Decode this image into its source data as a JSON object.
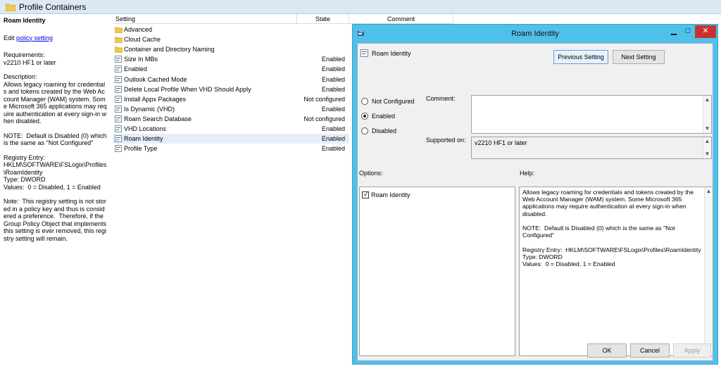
{
  "header": {
    "title": "Profile Containers"
  },
  "left_pane": {
    "heading": "Roam Identity",
    "edit_prefix": "Edit ",
    "edit_link": "policy setting",
    "requirements_label": "Requirements:",
    "requirements_value": "v2210 HF1 or later",
    "description_label": "Description:",
    "description_text": "Allows legacy roaming for credentials and tokens created by the Web Account Manager (WAM) system. Some Microsoft 365 applications may require authentication at every sign-in when disabled.",
    "note": "NOTE:  Default is Disabled (0) which is the same as \"Not Configured\"",
    "registry_label": "Registry Entry:",
    "registry_path": "HKLM\\SOFTWARE\\FSLogix\\Profiles\\RoamIdentity",
    "registry_type": "Type: DWORD",
    "registry_values": "Values:  0 = Disabled, 1 = Enabled",
    "note2": "Note:  This registry setting is not stored in a policy key and thus is considered a preference.  Therefore, if the Group Policy Object that implements this setting is ever removed, this registry setting will remain."
  },
  "list": {
    "columns": {
      "setting": "Setting",
      "state": "State",
      "comment": "Comment"
    },
    "rows": [
      {
        "name": "Advanced",
        "state": "",
        "icon": "folder-icon"
      },
      {
        "name": "Cloud Cache",
        "state": "",
        "icon": "folder-icon"
      },
      {
        "name": "Container and Directory Naming",
        "state": "",
        "icon": "folder-icon"
      },
      {
        "name": "Size In MBs",
        "state": "Enabled",
        "icon": "policy-icon"
      },
      {
        "name": "Enabled",
        "state": "Enabled",
        "icon": "policy-icon"
      },
      {
        "name": "Outlook Cached Mode",
        "state": "Enabled",
        "icon": "policy-icon"
      },
      {
        "name": "Delete Local Profile When VHD Should Apply",
        "state": "Enabled",
        "icon": "policy-icon"
      },
      {
        "name": "Install Appx Packages",
        "state": "Not configured",
        "icon": "policy-icon"
      },
      {
        "name": "Is Dynamic (VHD)",
        "state": "Enabled",
        "icon": "policy-icon"
      },
      {
        "name": "Roam Search Database",
        "state": "Not configured",
        "icon": "policy-icon"
      },
      {
        "name": "VHD Locations",
        "state": "Enabled",
        "icon": "policy-icon"
      },
      {
        "name": "Roam Identity",
        "state": "Enabled",
        "icon": "policy-icon",
        "selected": true
      },
      {
        "name": "Profile Type",
        "state": "Enabled",
        "icon": "policy-icon"
      }
    ]
  },
  "dialog": {
    "title": "Roam Identity",
    "policy_name": "Roam Identity",
    "prev_button": "Previous Setting",
    "next_button": "Next Setting",
    "radio_not_configured": "Not Configured",
    "radio_enabled": "Enabled",
    "radio_disabled": "Disabled",
    "selected_option": "Enabled",
    "comment_label": "Comment:",
    "comment_value": "",
    "supported_label": "Supported on:",
    "supported_value": "v2210 HF1 or later",
    "options_label": "Options:",
    "help_label": "Help:",
    "option_checkbox_label": "Roam Identity",
    "option_checked": true,
    "help_text": "Allows legacy roaming for credentials and tokens created by the Web Account Manager (WAM) system. Some Microsoft 365 applications may require authentication at every sign-in when disabled.\n\nNOTE:  Default is Disabled (0) which is the same as \"Not Configured\"\n\nRegistry Entry:  HKLM\\SOFTWARE\\FSLogix\\Profiles\\RoamIdentity\nType: DWORD\nValues:  0 = Disabled, 1 = Enabled",
    "ok_button": "OK",
    "cancel_button": "Cancel",
    "apply_button": "Apply",
    "minimize_glyph": "▁",
    "maximize_glyph": "□",
    "close_glyph": "✕"
  },
  "colors": {
    "dialog_frame": "#4fc1e9",
    "close_button": "#c7312f",
    "header_bar": "#dde8f5",
    "link": "#0000ee"
  }
}
